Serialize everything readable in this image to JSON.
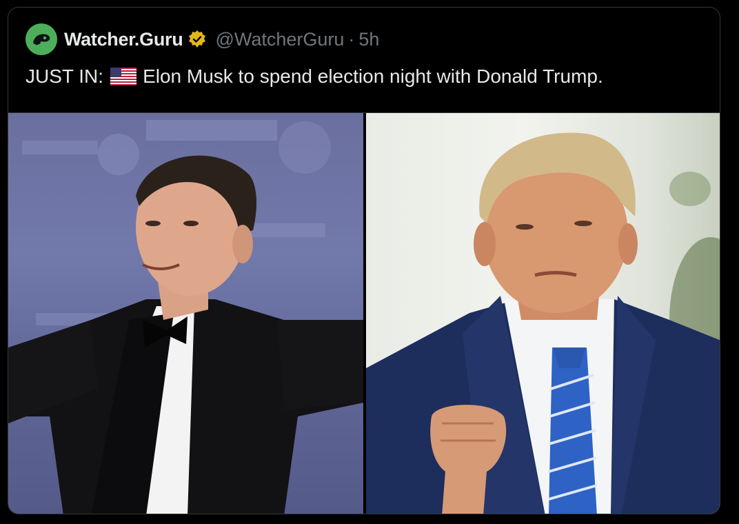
{
  "tweet": {
    "author": {
      "display_name": "Watcher.Guru",
      "handle": "@WatcherGuru",
      "separator": "·",
      "time": "5h",
      "avatar_icon": "watcher-guru-logo-icon",
      "verified_icon": "verified-badge-icon",
      "avatar_color": "#4cae5b",
      "verified_color": "#e2b719"
    },
    "text_prefix": "JUST IN:",
    "flag_icon": "us-flag-icon",
    "text_body": "Elon Musk to spend election night with Donald Trump."
  },
  "media": {
    "left_photo": "photo-elon-musk",
    "right_photo": "photo-donald-trump"
  }
}
